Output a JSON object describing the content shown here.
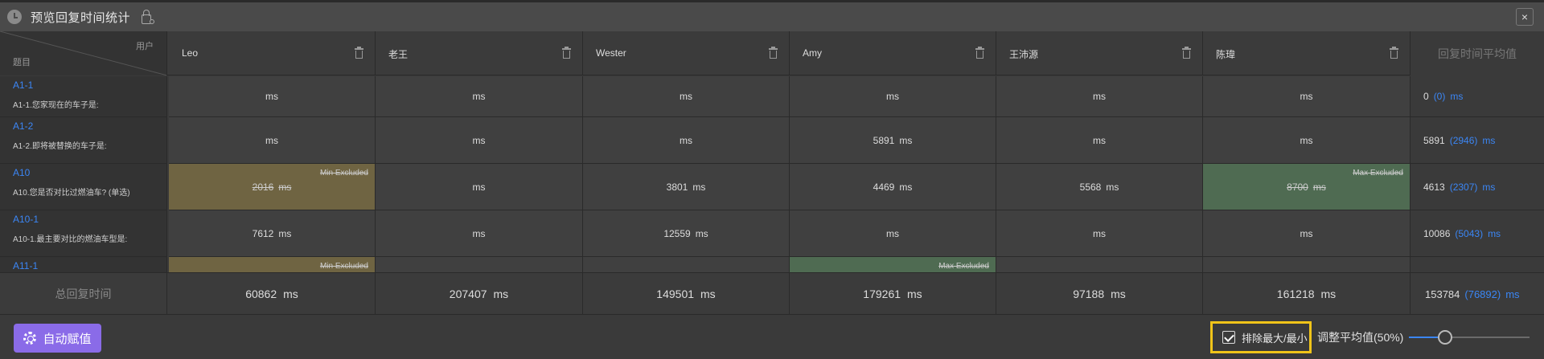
{
  "window": {
    "title": "预览回复时间统计",
    "close_label": "×"
  },
  "corner": {
    "user_label": "用户",
    "question_label": "题目"
  },
  "users": [
    {
      "name": "Leo"
    },
    {
      "name": "老王"
    },
    {
      "name": "Wester"
    },
    {
      "name": "Amy"
    },
    {
      "name": "王沛源"
    },
    {
      "name": "陈瑋"
    }
  ],
  "avg_header": "回复时间平均值",
  "unit": "ms",
  "rows": [
    {
      "code": "A1-1",
      "desc": "A1-1.您家现在的车子是:",
      "cells": [
        {
          "v": ""
        },
        {
          "v": ""
        },
        {
          "v": ""
        },
        {
          "v": ""
        },
        {
          "v": ""
        },
        {
          "v": ""
        }
      ],
      "avg": "0",
      "adj": "(0)"
    },
    {
      "code": "A1-2",
      "desc": "A1-2.即将被替换的车子是:",
      "cells": [
        {
          "v": ""
        },
        {
          "v": ""
        },
        {
          "v": ""
        },
        {
          "v": "5891"
        },
        {
          "v": ""
        },
        {
          "v": ""
        }
      ],
      "avg": "5891",
      "adj": "(2946)"
    },
    {
      "code": "A10",
      "desc": "A10.您是否对比过燃油车? (单选)",
      "cells": [
        {
          "v": "2016",
          "tag": "Min Excluded",
          "type": "min"
        },
        {
          "v": ""
        },
        {
          "v": "3801"
        },
        {
          "v": "4469"
        },
        {
          "v": "5568"
        },
        {
          "v": "8700",
          "tag": "Max Excluded",
          "type": "max"
        }
      ],
      "avg": "4613",
      "adj": "(2307)"
    },
    {
      "code": "A10-1",
      "desc": "A10-1.最主要对比的燃油车型是:",
      "cells": [
        {
          "v": "7612"
        },
        {
          "v": ""
        },
        {
          "v": "12559"
        },
        {
          "v": ""
        },
        {
          "v": ""
        },
        {
          "v": ""
        }
      ],
      "avg": "10086",
      "adj": "(5043)"
    },
    {
      "code": "A11-1",
      "desc": "",
      "cells": [
        {
          "v": "",
          "tag": "Min Excluded",
          "type": "min"
        },
        {
          "v": ""
        },
        {
          "v": ""
        },
        {
          "v": "",
          "tag": "Max Excluded",
          "type": "max"
        },
        {
          "v": ""
        },
        {
          "v": ""
        }
      ],
      "avg": "",
      "adj": ""
    }
  ],
  "totals": {
    "label": "总回复时间",
    "values": [
      "60862",
      "207407",
      "149501",
      "179261",
      "97188",
      "161218"
    ],
    "avg": "153784",
    "adj": "(76892)"
  },
  "footer": {
    "auto_button": "自动赋值",
    "exclude_label": "排除最大/最小",
    "exclude_checked": true,
    "adjust_label": "调整平均值(50%)",
    "slider_value": 0.3
  },
  "colors": {
    "accent": "#3b86f5",
    "min_excluded": "#6f6442",
    "max_excluded": "#4f6b52",
    "button": "#8a6be8",
    "highlight": "#f0c419"
  }
}
